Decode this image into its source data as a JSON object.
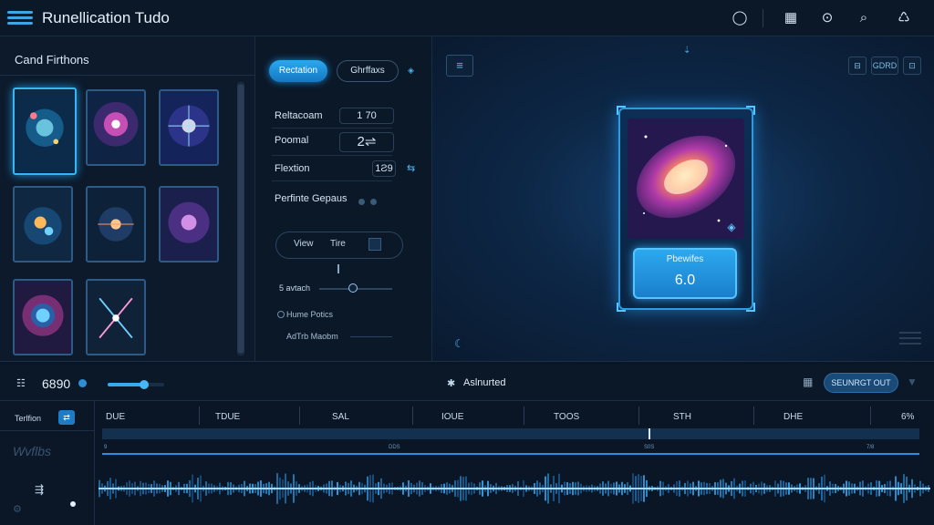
{
  "app": {
    "title": "Runellication Tudo"
  },
  "topbar": {
    "icons": [
      "circle-icon",
      "grid-doc-icon",
      "alert-search-icon",
      "search-icon",
      "recycle-icon"
    ]
  },
  "card_panel": {
    "title": "Cand Firthons",
    "cards": [
      "card-1",
      "card-2",
      "card-3",
      "card-4",
      "card-5",
      "card-6",
      "card-7",
      "card-8"
    ],
    "selected_index": 0
  },
  "controls": {
    "primary_button": "Rectation",
    "secondary_button": "Ghrffaxs",
    "properties": [
      {
        "label": "Reltacoam",
        "value": "1 70"
      },
      {
        "label": "Poomal",
        "value": "2⇌"
      },
      {
        "label": "Flextion",
        "value": "1Ƨ9"
      }
    ],
    "toggle_label": "Perfinte Gepaus",
    "view": {
      "label": "View",
      "value": "Tire"
    },
    "slider": {
      "label": "5 avtach",
      "value": 0.45
    },
    "radio_label": "Hume Potics",
    "mode_label": "AdTrb Maobm"
  },
  "preview": {
    "toolbar": [
      "≡",
      "⊟",
      "GDRD",
      "⊡"
    ],
    "card": {
      "stat_label": "Pbewifes",
      "stat_value": "6.0"
    }
  },
  "timeline": {
    "count": "6890",
    "zoom": 0.65,
    "status": "Aslnurted",
    "export_button": "SEUNRGT OUT",
    "layer_label": "Terlfion",
    "side_title": "Wvflbs",
    "ruler": [
      "DUE",
      "TDUE",
      "SAL",
      "IOUE",
      "TOOS",
      "STH",
      "DHE",
      "6%"
    ],
    "track_labels": [
      "9",
      "DDS",
      "S0S",
      "7/8"
    ]
  },
  "colors": {
    "accent": "#2aa8ee",
    "background": "#0a1626",
    "panel": "#0c1a2b"
  }
}
